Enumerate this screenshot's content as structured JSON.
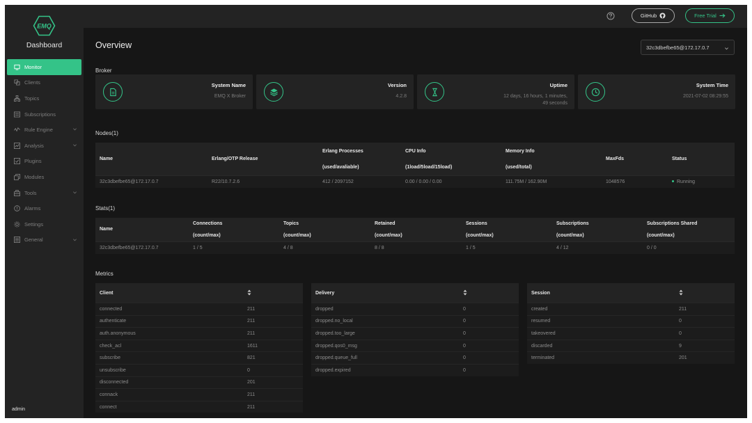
{
  "sidebar": {
    "logo_text": "EMQ",
    "brand": "Dashboard",
    "items": [
      {
        "label": "Monitor"
      },
      {
        "label": "Clients"
      },
      {
        "label": "Topics"
      },
      {
        "label": "Subscriptions"
      },
      {
        "label": "Rule Engine"
      },
      {
        "label": "Analysis"
      },
      {
        "label": "Plugins"
      },
      {
        "label": "Modules"
      },
      {
        "label": "Tools"
      },
      {
        "label": "Alarms"
      },
      {
        "label": "Settings"
      },
      {
        "label": "General"
      }
    ],
    "user": "admin"
  },
  "header": {
    "github_label": "GitHub",
    "trial_label": "Free Trial"
  },
  "page": {
    "title": "Overview",
    "node_select": "32c3dbefbe65@172.17.0.7"
  },
  "broker": {
    "section": "Broker",
    "cards": [
      {
        "label": "System Name",
        "value": "EMQ X Broker"
      },
      {
        "label": "Version",
        "value": "4.2.8"
      },
      {
        "label": "Uptime",
        "value": "12 days, 16 hours, 1 minutes, 49 seconds"
      },
      {
        "label": "System Time",
        "value": "2021-07-02 08:29:55"
      }
    ]
  },
  "nodes": {
    "section": "Nodes(1)",
    "headers": {
      "name": "Name",
      "release": "Erlang/OTP Release",
      "proc": "Erlang Processes",
      "proc_sub": "(used/avaliable)",
      "cpu": "CPU Info",
      "cpu_sub": "(1load/5load/15load)",
      "mem": "Memory Info",
      "mem_sub": "(used/total)",
      "maxfds": "MaxFds",
      "status": "Status"
    },
    "row": {
      "name": "32c3dbefbe65@172.17.0.7",
      "release": "R22/10.7.2.6",
      "proc": "412 / 2097152",
      "cpu": "0.00 / 0.00 / 0.00",
      "mem": "111.75M / 162.90M",
      "maxfds": "1048576",
      "status": "Running"
    }
  },
  "stats": {
    "section": "Stats(1)",
    "headers": {
      "name": "Name",
      "connections": "Connections",
      "topics": "Topics",
      "retained": "Retained",
      "sessions": "Sessions",
      "subscriptions": "Subscriptions",
      "subs_shared": "Subscriptions Shared",
      "sub": "(count/max)"
    },
    "row": {
      "name": "32c3dbefbe65@172.17.0.7",
      "connections": "1 / 5",
      "topics": "4 / 8",
      "retained": "8 / 8",
      "sessions": "1 / 5",
      "subscriptions": "4 / 12",
      "subs_shared": "0 / 0"
    }
  },
  "metrics": {
    "section": "Metrics",
    "client": {
      "title": "Client",
      "rows": [
        {
          "key": "connected",
          "value": "211"
        },
        {
          "key": "authenticate",
          "value": "211"
        },
        {
          "key": "auth.anonymous",
          "value": "211"
        },
        {
          "key": "check_acl",
          "value": "1611"
        },
        {
          "key": "subscribe",
          "value": "821"
        },
        {
          "key": "unsubscribe",
          "value": "0"
        },
        {
          "key": "disconnected",
          "value": "201"
        },
        {
          "key": "connack",
          "value": "211"
        },
        {
          "key": "connect",
          "value": "211"
        }
      ]
    },
    "delivery": {
      "title": "Delivery",
      "rows": [
        {
          "key": "dropped",
          "value": "0"
        },
        {
          "key": "dropped.no_local",
          "value": "0"
        },
        {
          "key": "dropped.too_large",
          "value": "0"
        },
        {
          "key": "dropped.qos0_msg",
          "value": "0"
        },
        {
          "key": "dropped.queue_full",
          "value": "0"
        },
        {
          "key": "dropped.expired",
          "value": "0"
        }
      ]
    },
    "session": {
      "title": "Session",
      "rows": [
        {
          "key": "created",
          "value": "211"
        },
        {
          "key": "resumed",
          "value": "0"
        },
        {
          "key": "takeovered",
          "value": "0"
        },
        {
          "key": "discarded",
          "value": "9"
        },
        {
          "key": "terminated",
          "value": "201"
        }
      ]
    }
  },
  "colors": {
    "accent": "#34c388",
    "background": "#161616",
    "panel": "#232323"
  }
}
